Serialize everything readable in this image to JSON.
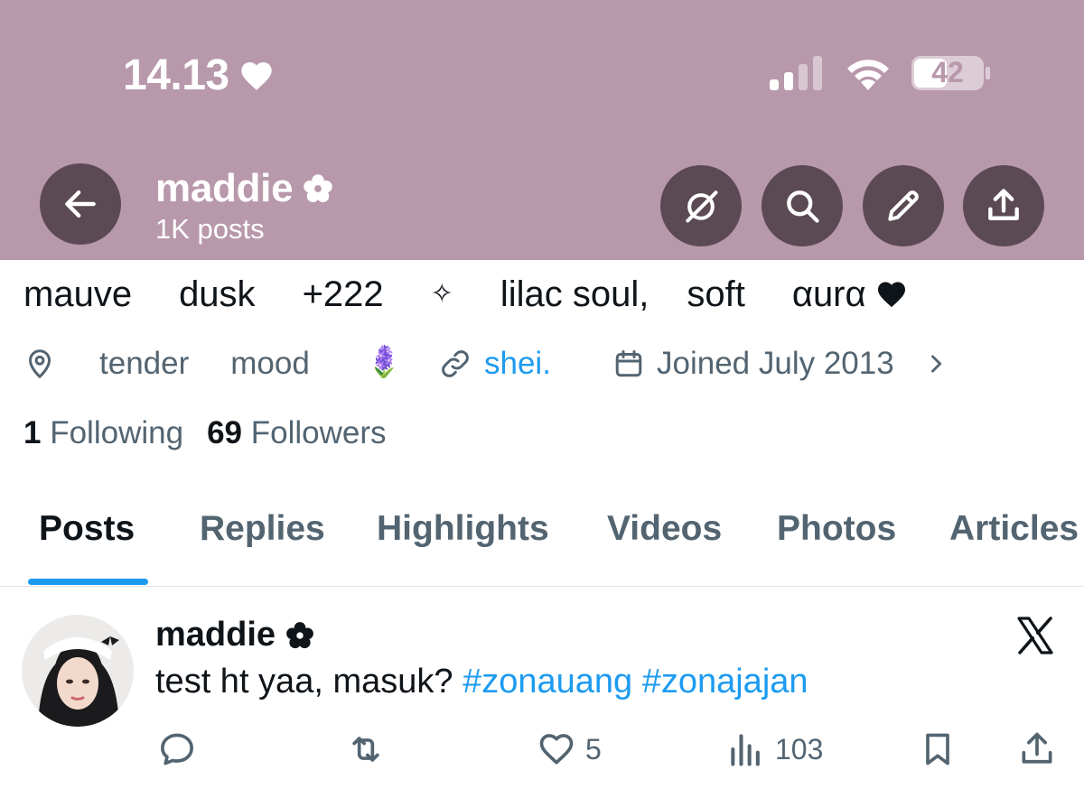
{
  "status_bar": {
    "time": "14.13",
    "battery": "42",
    "icons": [
      "heart-icon",
      "signal-icon",
      "wifi-icon",
      "battery-icon"
    ]
  },
  "header": {
    "name": "maddie",
    "posts_count": "1K posts",
    "background_color": "#b898ab",
    "button_color": "#5b4a53",
    "buttons": [
      "back-arrow-icon",
      "grok-icon",
      "search-icon",
      "pencil-icon",
      "share-icon"
    ]
  },
  "profile": {
    "bio": {
      "w1": "mauve",
      "w2": "dusk",
      "w3": "+222",
      "w4": "✧",
      "w5": "lilac soul,",
      "w6": "soft",
      "w7": "αurα"
    },
    "location": {
      "w1": "tender",
      "w2": "mood",
      "emoji": "🪻"
    },
    "link": "shei.",
    "joined": "Joined July 2013",
    "following_count": "1",
    "following_label": "Following",
    "followers_count": "69",
    "followers_label": "Followers"
  },
  "tabs": [
    {
      "label": "Posts",
      "active": true
    },
    {
      "label": "Replies",
      "active": false
    },
    {
      "label": "Highlights",
      "active": false
    },
    {
      "label": "Videos",
      "active": false
    },
    {
      "label": "Photos",
      "active": false
    },
    {
      "label": "Articles",
      "active": false
    }
  ],
  "post": {
    "author": "maddie",
    "text_plain": "test ht yaa, masuk?",
    "hashtag1": "#zonauang",
    "hashtag2": "#zonajajan",
    "likes": "5",
    "views": "103",
    "action_icons": [
      "reply-icon",
      "retweet-icon",
      "heart-icon",
      "views-icon",
      "bookmark-icon",
      "share-icon"
    ]
  },
  "colors": {
    "accent": "#1d9bf0",
    "text_primary": "#0f1419",
    "text_secondary": "#536471"
  }
}
